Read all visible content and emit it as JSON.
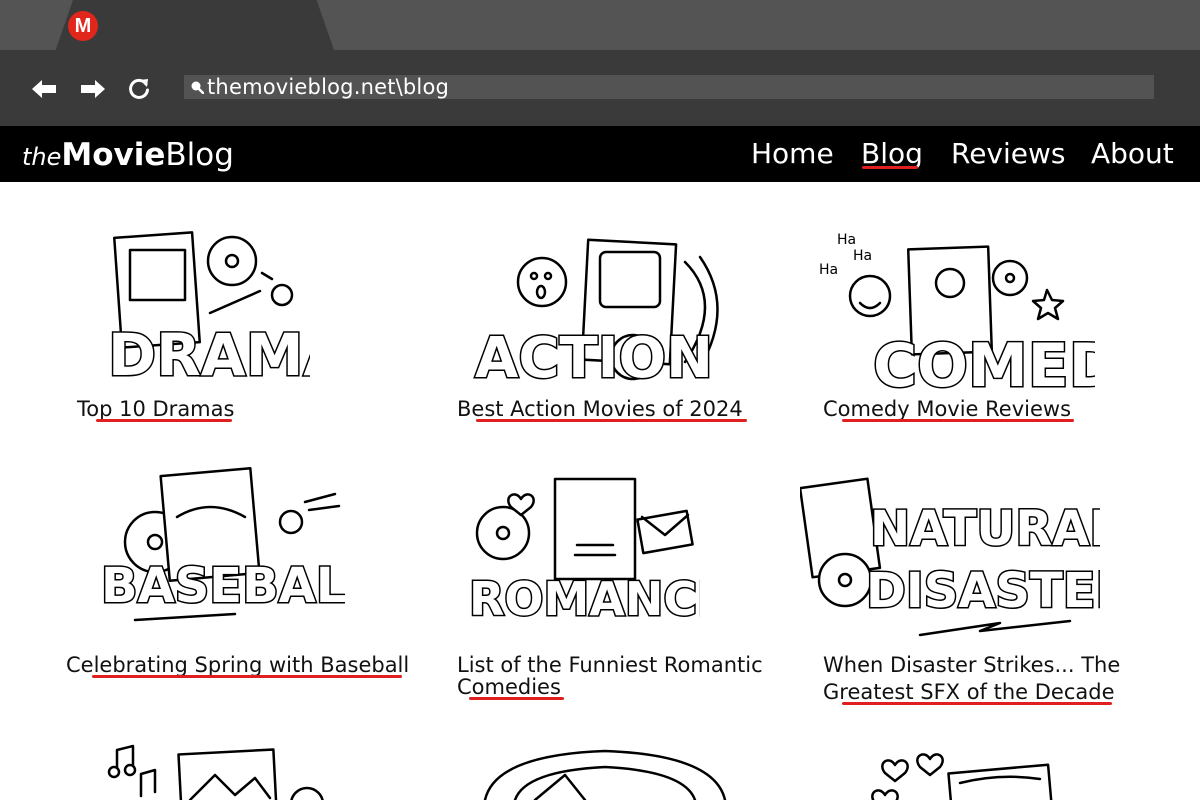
{
  "browser": {
    "favicon_letter": "M",
    "url": "themovieblog.net\\blog",
    "icons": [
      "back-arrow-icon",
      "forward-arrow-icon",
      "reload-icon",
      "search-icon"
    ]
  },
  "site": {
    "logo": {
      "the": "the",
      "movie": "Movie",
      "blog": "Blog"
    },
    "nav": {
      "home": "Home",
      "blog": "Blog",
      "reviews": "Reviews",
      "about": "About"
    },
    "active_nav": "Blog"
  },
  "colors": {
    "accent_red": "#e02020",
    "header_bg": "#000000",
    "chrome_dark": "#3a3a3a",
    "chrome_light": "#545454"
  },
  "cards": [
    {
      "art_word": "DRAMA",
      "title_lines": [
        "Top 10 Dramas"
      ]
    },
    {
      "art_word": "ACTION",
      "title_lines": [
        "Best Action Movies of 2024"
      ]
    },
    {
      "art_word": "COMEDY",
      "art_extra": [
        "Ha",
        "Ha",
        "Ha"
      ],
      "title_lines": [
        "Comedy Movie Reviews"
      ]
    },
    {
      "art_word": "BASEBALL",
      "title_lines": [
        "Celebrating Spring with Baseball"
      ]
    },
    {
      "art_word": "ROMANCE",
      "title_lines": [
        "List of the Funniest Romantic",
        "Comedies"
      ]
    },
    {
      "art_word_lines": [
        "NATURAL",
        "DISASTER"
      ],
      "title_lines": [
        "When Disaster Strikes... The",
        "Greatest SFX of the Decade"
      ]
    }
  ]
}
